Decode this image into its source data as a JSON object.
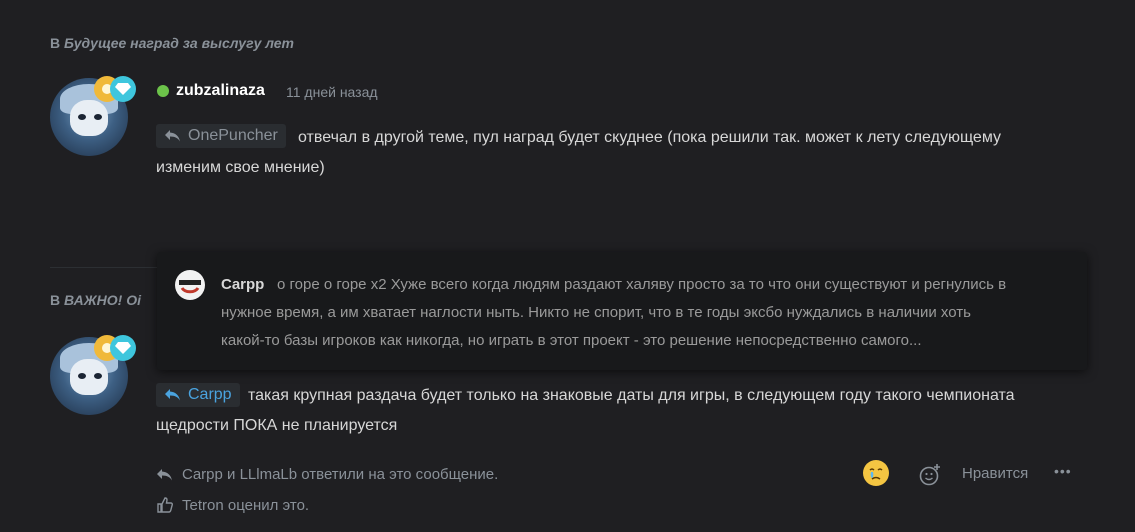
{
  "thread_context_1": {
    "prefix": "В",
    "title": "Будущее наград за выслугу лет"
  },
  "thread_context_2": {
    "prefix": "В",
    "title": "ВАЖНО! Оі"
  },
  "post1": {
    "username": "zubzalinaza",
    "time": "11 дней назад",
    "reply_to": "OnePuncher",
    "text_line1": "отвечал в другой теме, пул наград будет скуднее (пока решили так. может к лету следующему",
    "text_line2": "изменим свое мнение)"
  },
  "popover": {
    "name": "Carpp",
    "line1": "о горе о горе x2 Хуже всего когда людям раздают халяву просто за то что они существуют и регнулись в",
    "line2": "нужное время, а им хватает наглости ныть. Никто не спорит, что в те годы эксбо нуждались в наличии хоть",
    "line3": "какой-то базы игроков как никогда, но играть в этот проект - это решение непосредственно самого..."
  },
  "post2": {
    "reply_to": "Carpp",
    "text_line1": "такая крупная раздача будет только на знаковые даты для игры, в следующем году такого чемпионата",
    "text_line2": "щедрости ПОКА не планируется",
    "replies_text": "Carpp и LLlmaLb ответили на это сообщение.",
    "likes_text": "Tetron оценил это.",
    "like_label": "Нравится",
    "more_label": "•••"
  },
  "icons": {
    "reply": "reply-arrow-icon",
    "like": "thumbs-up-icon",
    "reaction": "crying-face-icon",
    "add_reaction": "add-emoji-icon"
  },
  "colors": {
    "accent": "#4aa3df",
    "online": "#6cc34a",
    "background": "#1f1f22"
  }
}
